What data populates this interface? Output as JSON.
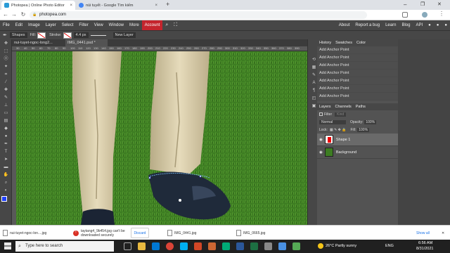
{
  "browser": {
    "tabs": [
      {
        "label": "Photopea | Online Photo Editor",
        "active": true,
        "color": "#2a9ad6"
      },
      {
        "label": "núi tuyết - Google Tìm kiếm",
        "active": false,
        "color": "#4285f4"
      }
    ],
    "new_tab": "+",
    "minimize": "–",
    "restore": "❐",
    "close": "✕",
    "tab_close": "×",
    "back": "←",
    "forward": "→",
    "reload": "↻",
    "lock": "🔒",
    "url": "photopea.com"
  },
  "menu": {
    "items": [
      "File",
      "Edit",
      "Image",
      "Layer",
      "Select",
      "Filter",
      "View",
      "Window",
      "More"
    ],
    "account": "Account",
    "right_links": [
      "About",
      "Report a bug",
      "Learn",
      "Blog",
      "API"
    ]
  },
  "options": {
    "shapes": "Shapes",
    "fill": "Fill:",
    "stroke": "Stroke:",
    "stroke_width": "4.4 px",
    "new_layer": "New Layer"
  },
  "doc_tabs": [
    {
      "label": "nui-tuyet-ngoc-long2...",
      "active": false
    },
    {
      "label": "IMG_0441.psd *",
      "active": true
    }
  ],
  "ruler_ticks": [
    "30",
    "40",
    "50",
    "60",
    "70",
    "80",
    "90",
    "100",
    "110",
    "120",
    "130",
    "140",
    "150",
    "160",
    "170",
    "180",
    "190",
    "200",
    "210",
    "220",
    "230",
    "240",
    "250",
    "260",
    "270",
    "280",
    "290",
    "300",
    "310",
    "320",
    "330",
    "340",
    "350",
    "360",
    "370",
    "380",
    "390"
  ],
  "history": {
    "tabs": [
      "History",
      "Swatches",
      "Color"
    ],
    "items": [
      "Add Anchor Point",
      "Add Anchor Point",
      "Add Anchor Point",
      "Add Anchor Point",
      "Add Anchor Point",
      "Add Anchor Point",
      "Add Anchor Point"
    ]
  },
  "layers": {
    "tabs": [
      "Layers",
      "Channels",
      "Paths"
    ],
    "filter": "Filter",
    "kind": "Kind",
    "blend": "Normal",
    "opacity_label": "Opacity:",
    "opacity": "100%",
    "lock_label": "Lock:",
    "fill_label": "Fill:",
    "fill": "100%",
    "items": [
      {
        "name": "Shape 1",
        "selected": true
      },
      {
        "name": "Background",
        "selected": false
      }
    ]
  },
  "downloads": [
    {
      "name": "nui-tuyet-ngoc-lon....jpg",
      "warning": false
    },
    {
      "name": "taytang4_9b454.jpg can't be downloaded securely",
      "warning": true
    },
    {
      "name": "IMG_0441.jpg",
      "warning": false
    },
    {
      "name": "IMG_0665.jpg",
      "warning": false
    }
  ],
  "discard": "Discard",
  "show_all": "Show all",
  "taskbar": {
    "search_placeholder": "Type here to search",
    "weather": "26°C  Partly sunny",
    "lang": "ENG",
    "time": "6:56 AM",
    "date": "8/31/2021"
  }
}
